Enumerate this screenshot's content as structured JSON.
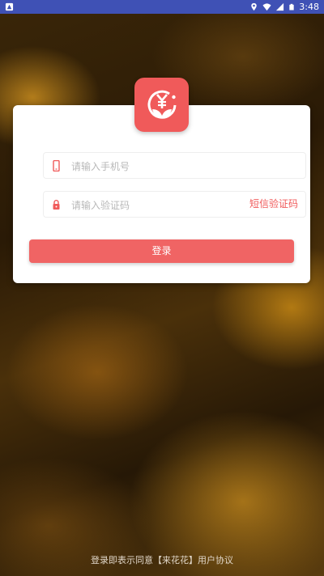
{
  "status_bar": {
    "time": "3:48",
    "left_icon": "notification-icon",
    "right_icons": [
      "location-icon",
      "wifi-icon",
      "signal-icon",
      "battery-icon"
    ],
    "background": "#3f51b5"
  },
  "logo": {
    "icon": "yuan-flower-logo-icon",
    "background": "#f05a5a"
  },
  "login_form": {
    "phone_placeholder": "请输入手机号",
    "phone_icon": "phone-icon",
    "code_placeholder": "请输入验证码",
    "code_icon": "lock-icon",
    "sms_button_label": "短信验证码",
    "login_button_label": "登录",
    "accent_color": "#f05a5a"
  },
  "agreement_text": "登录即表示同意【来花花】用户协议"
}
